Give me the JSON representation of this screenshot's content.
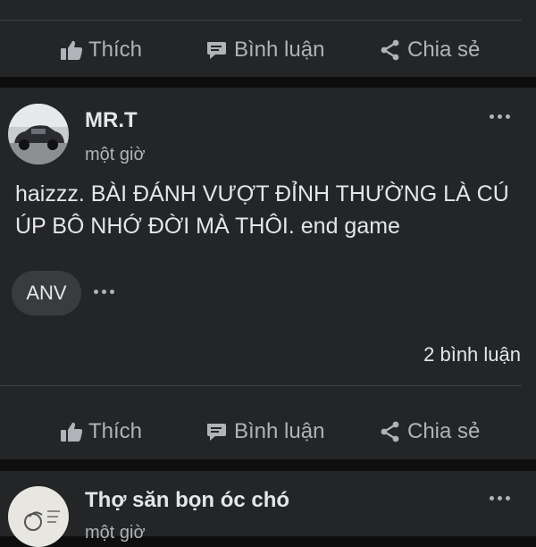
{
  "actions": {
    "like_label": "Thích",
    "comment_label": "Bình luận",
    "share_label": "Chia sẻ"
  },
  "post": {
    "author": "MR.T",
    "time": "một giờ",
    "text": "haizzz. BÀI ĐÁNH VƯỢT ĐỈNH THƯỜNG LÀ CÚ ÚP BÔ NHỚ ĐỜI MÀ THÔI. end game",
    "reaction_chip": "ANV",
    "comment_count": "2 bình luận"
  },
  "next_post": {
    "author": "Thợ săn bọn óc chó",
    "time": "một giờ"
  },
  "icons": {
    "like": "thumbs-up-icon",
    "comment": "comment-icon",
    "share": "share-icon",
    "more": "more-dots-icon"
  }
}
